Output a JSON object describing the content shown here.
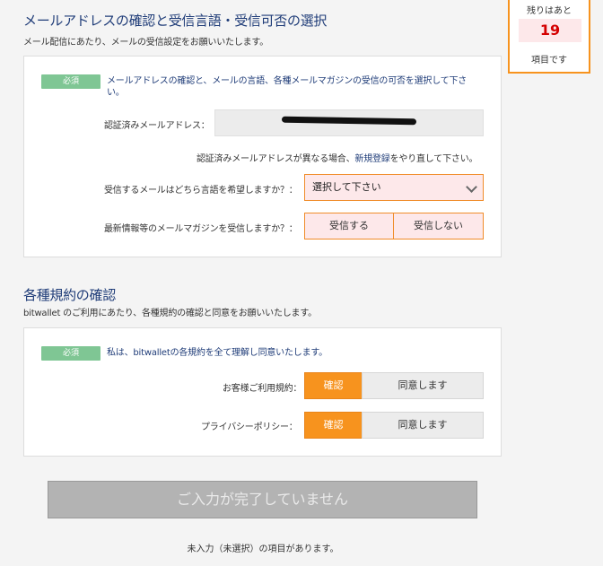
{
  "section1": {
    "title": "メールアドレスの確認と受信言語・受信可否の選択",
    "subtitle": "メール配信にあたり、メールの受信設定をお願いいたします。",
    "badge": "必須",
    "note": "メールアドレスの確認と、メールの言語、各種メールマガジンの受信の可否を選択して下さい。",
    "email_label": "認証済みメールアドレス：",
    "email_value_redacted": true,
    "different_note_prefix": "認証済みメールアドレスが異なる場合、",
    "different_note_link": "新規登録",
    "different_note_suffix": "をやり直して下さい。",
    "lang_label": "受信するメールはどちら言語を希望しますか？：",
    "lang_select_value": "選択して下さい",
    "magazine_label": "最新情報等のメールマガジンを受信しますか？：",
    "magazine_yes": "受信する",
    "magazine_no": "受信しない"
  },
  "section2": {
    "title": "各種規約の確認",
    "subtitle": "bitwallet のご利用にあたり、各種規約の確認と同意をお願いいたします。",
    "badge": "必須",
    "note": "私は、bitwalletの各規約を全て理解し同意いたします。",
    "terms_label": "お客様ご利用規約：",
    "privacy_label": "プライバシーポリシー：",
    "confirm_label": "確認",
    "agree_label": "同意します"
  },
  "remaining": {
    "line1": "残りはあと",
    "count": "19",
    "line2": "項目です"
  },
  "submit": {
    "label": "ご入力が完了していません"
  },
  "footer": {
    "text": "未入力（未選択）の項目があります。"
  },
  "colors": {
    "heading": "#1f3c78",
    "badge": "#7fc694",
    "accent": "#f7931e",
    "error_bg": "#fde8ea",
    "count": "#d40000"
  },
  "icons": {
    "select_arrow": "chevron-down-icon"
  }
}
